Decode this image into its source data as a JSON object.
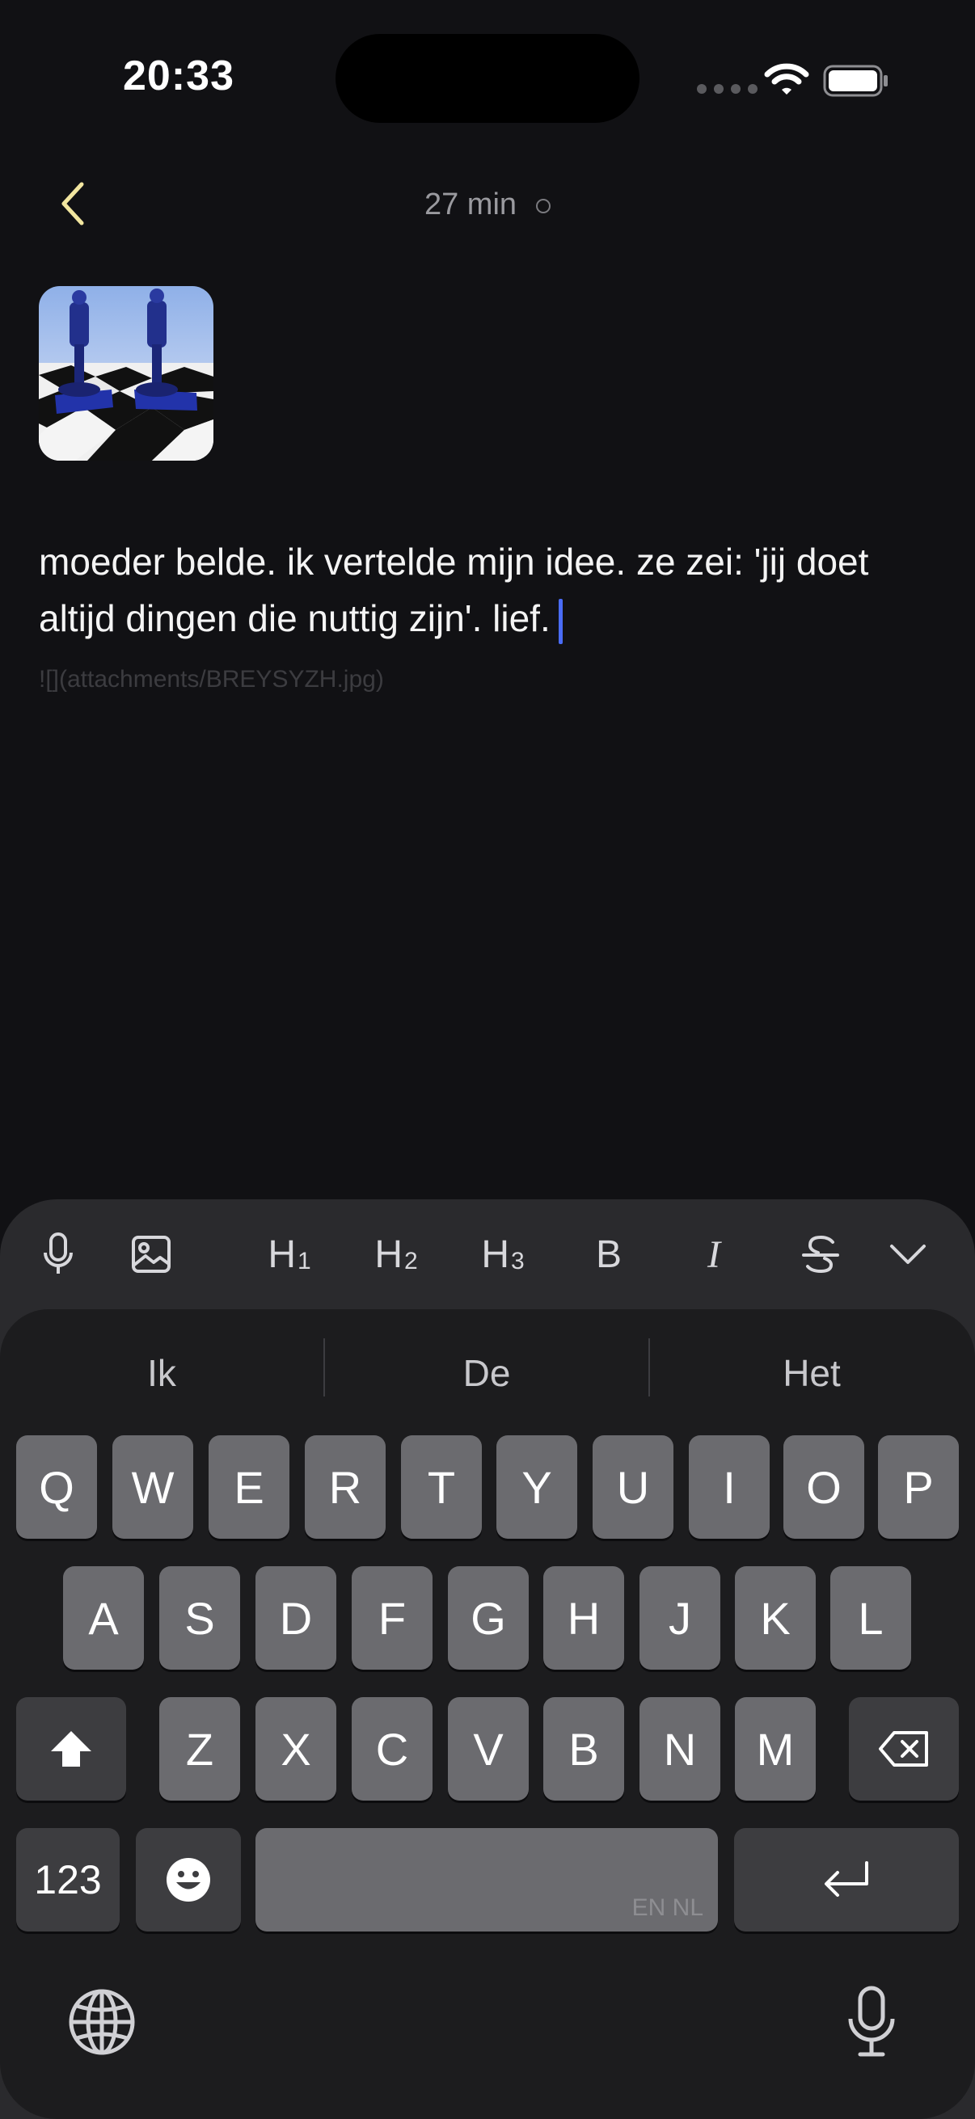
{
  "status": {
    "time": "20:33"
  },
  "nav": {
    "title": "27 min"
  },
  "note": {
    "thumbnail": "chess-pieces-image",
    "text": "moeder belde. ik vertelde mijn idee. ze zei: 'jij doet altijd dingen die nuttig zijn'. lief.",
    "attachment_ref": "![](attachments/BREYSYZH.jpg)"
  },
  "toolbar": {
    "h1": "H",
    "h1_sub": "1",
    "h2": "H",
    "h2_sub": "2",
    "h3": "H",
    "h3_sub": "3",
    "bold": "B",
    "italic": "I"
  },
  "keyboard": {
    "predictions": [
      "Ik",
      "De",
      "Het"
    ],
    "row1": [
      "Q",
      "W",
      "E",
      "R",
      "T",
      "Y",
      "U",
      "I",
      "O",
      "P"
    ],
    "row2": [
      "A",
      "S",
      "D",
      "F",
      "G",
      "H",
      "J",
      "K",
      "L"
    ],
    "row3": [
      "Z",
      "X",
      "C",
      "V",
      "B",
      "N",
      "M"
    ],
    "numbers_label": "123",
    "space_lang": "EN NL"
  },
  "colors": {
    "background": "#111114",
    "accent": "#4a6cf7",
    "back_arrow": "#f2e6a0"
  }
}
